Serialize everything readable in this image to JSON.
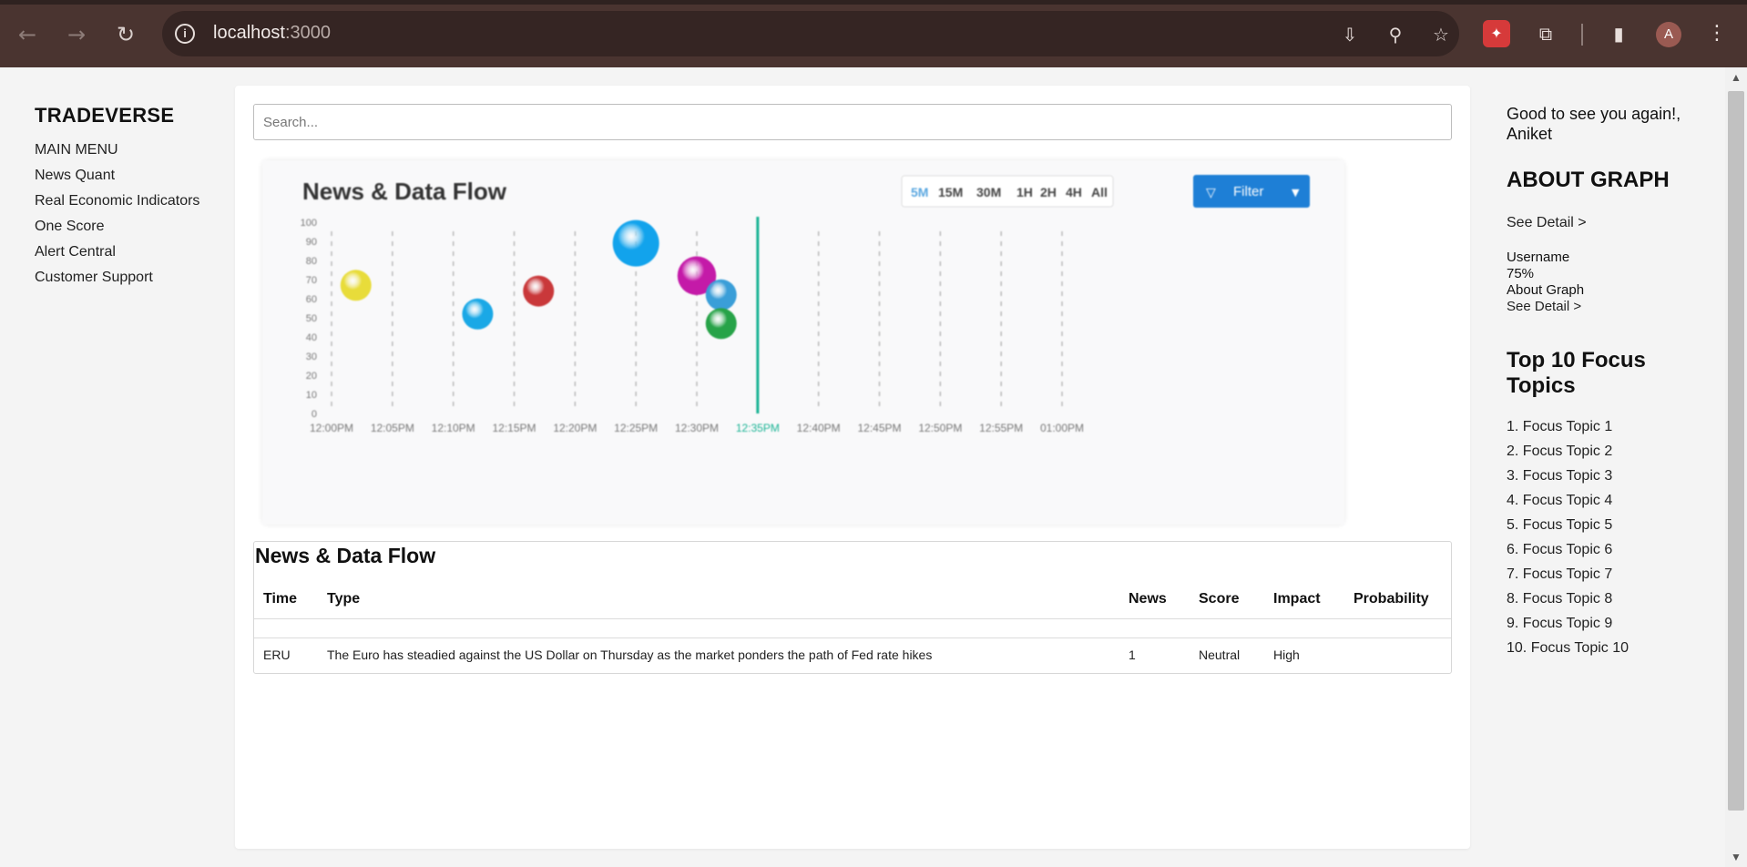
{
  "browser": {
    "url_host": "localhost",
    "url_port": ":3000",
    "avatar_letter": "A"
  },
  "sidebar": {
    "brand": "TRADEVERSE",
    "menu_heading": "MAIN MENU",
    "items": [
      {
        "label": "News Quant"
      },
      {
        "label": "Real Economic Indicators"
      },
      {
        "label": "One Score"
      },
      {
        "label": "Alert Central"
      },
      {
        "label": "Customer Support"
      }
    ]
  },
  "search": {
    "placeholder": "Search..."
  },
  "chart_image": {
    "title": "News & Data Flow",
    "timeframes": [
      "5M",
      "15M",
      "30M",
      "1H",
      "2H",
      "4H",
      "All"
    ],
    "active_timeframe": "5M",
    "filter_label": "Filter",
    "accent_color": "#1e7fd6",
    "now_line_color": "#1ab394"
  },
  "chart_data": {
    "type": "scatter",
    "title": "News & Data Flow",
    "x_ticks": [
      "12:00PM",
      "12:05PM",
      "12:10PM",
      "12:15PM",
      "12:20PM",
      "12:25PM",
      "12:30PM",
      "12:35PM",
      "12:40PM",
      "12:45PM",
      "12:50PM",
      "12:55PM",
      "01:00PM"
    ],
    "y_ticks": [
      0,
      10,
      20,
      30,
      40,
      50,
      60,
      70,
      80,
      90,
      100
    ],
    "ylim": [
      0,
      100
    ],
    "current_time": "12:35PM",
    "grid": "vertical dashed",
    "points": [
      {
        "time": "12:02PM",
        "value": 67,
        "size": 2,
        "color": "#e8dc3a"
      },
      {
        "time": "12:12PM",
        "value": 52,
        "size": 2,
        "color": "#1aa8e6"
      },
      {
        "time": "12:17PM",
        "value": 64,
        "size": 2,
        "color": "#c9383a"
      },
      {
        "time": "12:25PM",
        "value": 89,
        "size": 3,
        "color": "#12a3ec"
      },
      {
        "time": "12:30PM",
        "value": 72,
        "size": 2.5,
        "color": "#c41aa8"
      },
      {
        "time": "12:32PM",
        "value": 62,
        "size": 2,
        "color": "#3a9ed8"
      },
      {
        "time": "12:32PM",
        "value": 47,
        "size": 2,
        "color": "#27a348"
      }
    ]
  },
  "table": {
    "title": "News & Data Flow",
    "headers": {
      "time": "Time",
      "type": "Type",
      "news": "News",
      "score": "Score",
      "impact": "Impact",
      "probability": "Probability"
    },
    "rows": [
      {
        "time": "ERU",
        "type": "The Euro has steadied against the US Dollar on Thursday as the market ponders the path of Fed rate hikes",
        "news": "1",
        "score": "Neutral",
        "impact": "High",
        "probability": ""
      }
    ]
  },
  "right_sidebar": {
    "greeting": "Good to see you again!, Aniket",
    "about_title": "ABOUT GRAPH",
    "see_detail": "See Detail >",
    "username_label": "Username",
    "percent": "75%",
    "about_graph_label": "About Graph",
    "see_detail_2": "See Detail >",
    "topics_title": "Top 10 Focus Topics",
    "topics": [
      "1. Focus Topic 1",
      "2. Focus Topic 2",
      "3. Focus Topic 3",
      "4. Focus Topic 4",
      "5. Focus Topic 5",
      "6. Focus Topic 6",
      "7. Focus Topic 7",
      "8. Focus Topic 8",
      "9. Focus Topic 9",
      "10. Focus Topic 10"
    ]
  }
}
